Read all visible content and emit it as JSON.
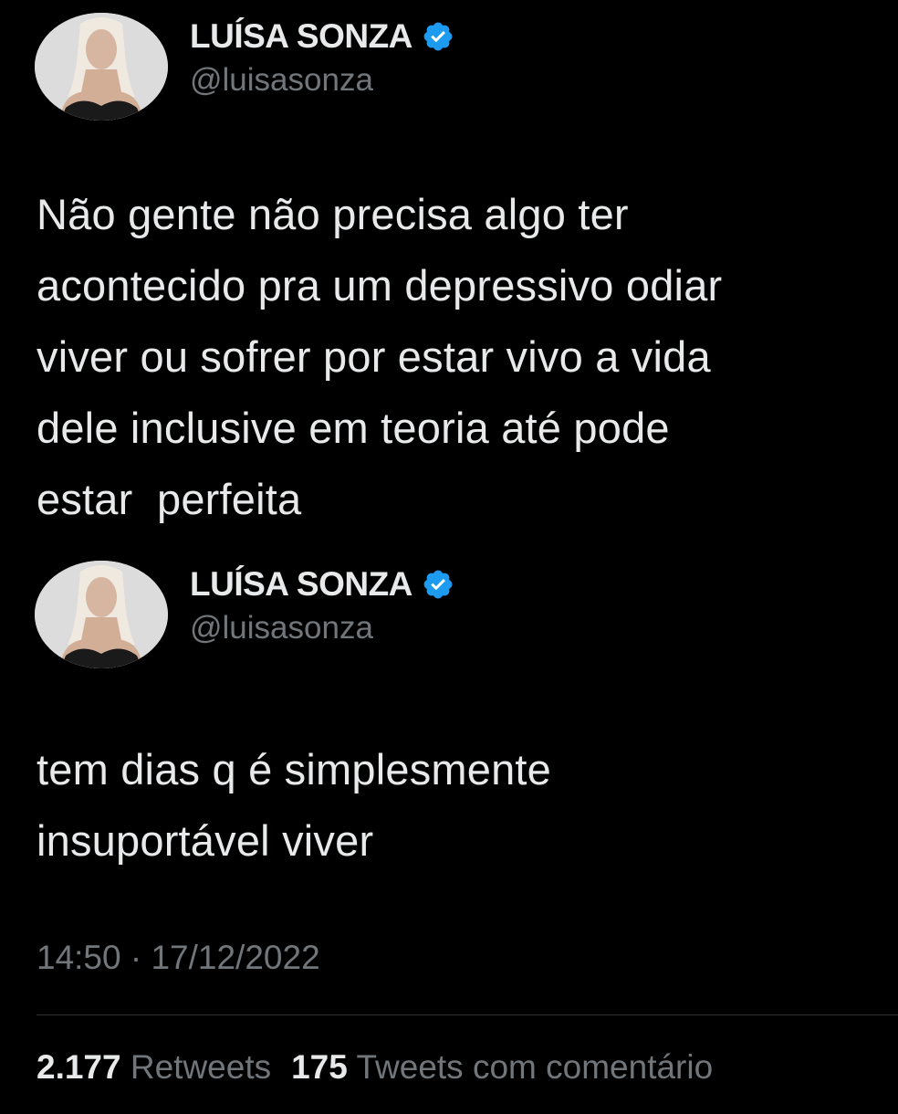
{
  "tweets": [
    {
      "display_name": "LUÍSA SONZA",
      "handle": "@luisasonza",
      "verified": true,
      "text": "Não gente não precisa algo ter\nacontecido pra um depressivo odiar\nviver ou sofrer por estar vivo a vida\ndele inclusive em teoria até pode\nestar  perfeita"
    },
    {
      "display_name": "LUÍSA SONZA",
      "handle": "@luisasonza",
      "verified": true,
      "text": "tem dias q é simplesmente\ninsuportável viver"
    }
  ],
  "timestamp": "14:50 · 17/12/2022",
  "stats": {
    "retweets_count": "2.177",
    "retweets_label": "Retweets",
    "quotes_count": "175",
    "quotes_label": "Tweets com comentário"
  },
  "colors": {
    "background": "#000000",
    "text_primary": "#e7e9ea",
    "text_secondary": "#71767b",
    "verified_badge": "#1d9bf0",
    "divider": "#2f3336"
  },
  "icons": {
    "verified": "verified-badge-icon",
    "avatar": "profile-photo"
  }
}
